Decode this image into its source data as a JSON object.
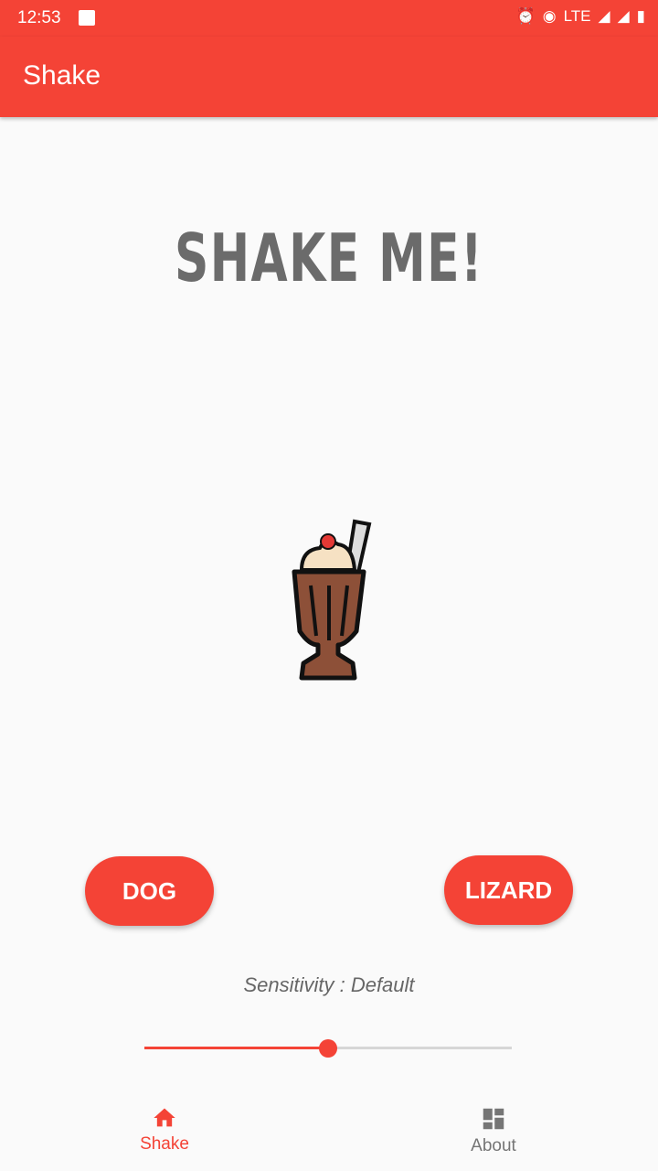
{
  "status_bar": {
    "time": "12:53",
    "network": "LTE"
  },
  "app_bar": {
    "title": "Shake"
  },
  "main": {
    "headline": "SHAKE ME!",
    "buttons": [
      {
        "label": "DOG"
      },
      {
        "label": "LIZARD"
      }
    ],
    "sensitivity_label": "Sensitivity : Default",
    "slider": {
      "value_percent": 50
    }
  },
  "bottom_nav": {
    "items": [
      {
        "label": "Shake",
        "icon": "home-icon",
        "active": true
      },
      {
        "label": "About",
        "icon": "dashboard-icon",
        "active": false
      }
    ]
  },
  "colors": {
    "primary": "#f44336",
    "text_gray": "#6b6b6b"
  }
}
